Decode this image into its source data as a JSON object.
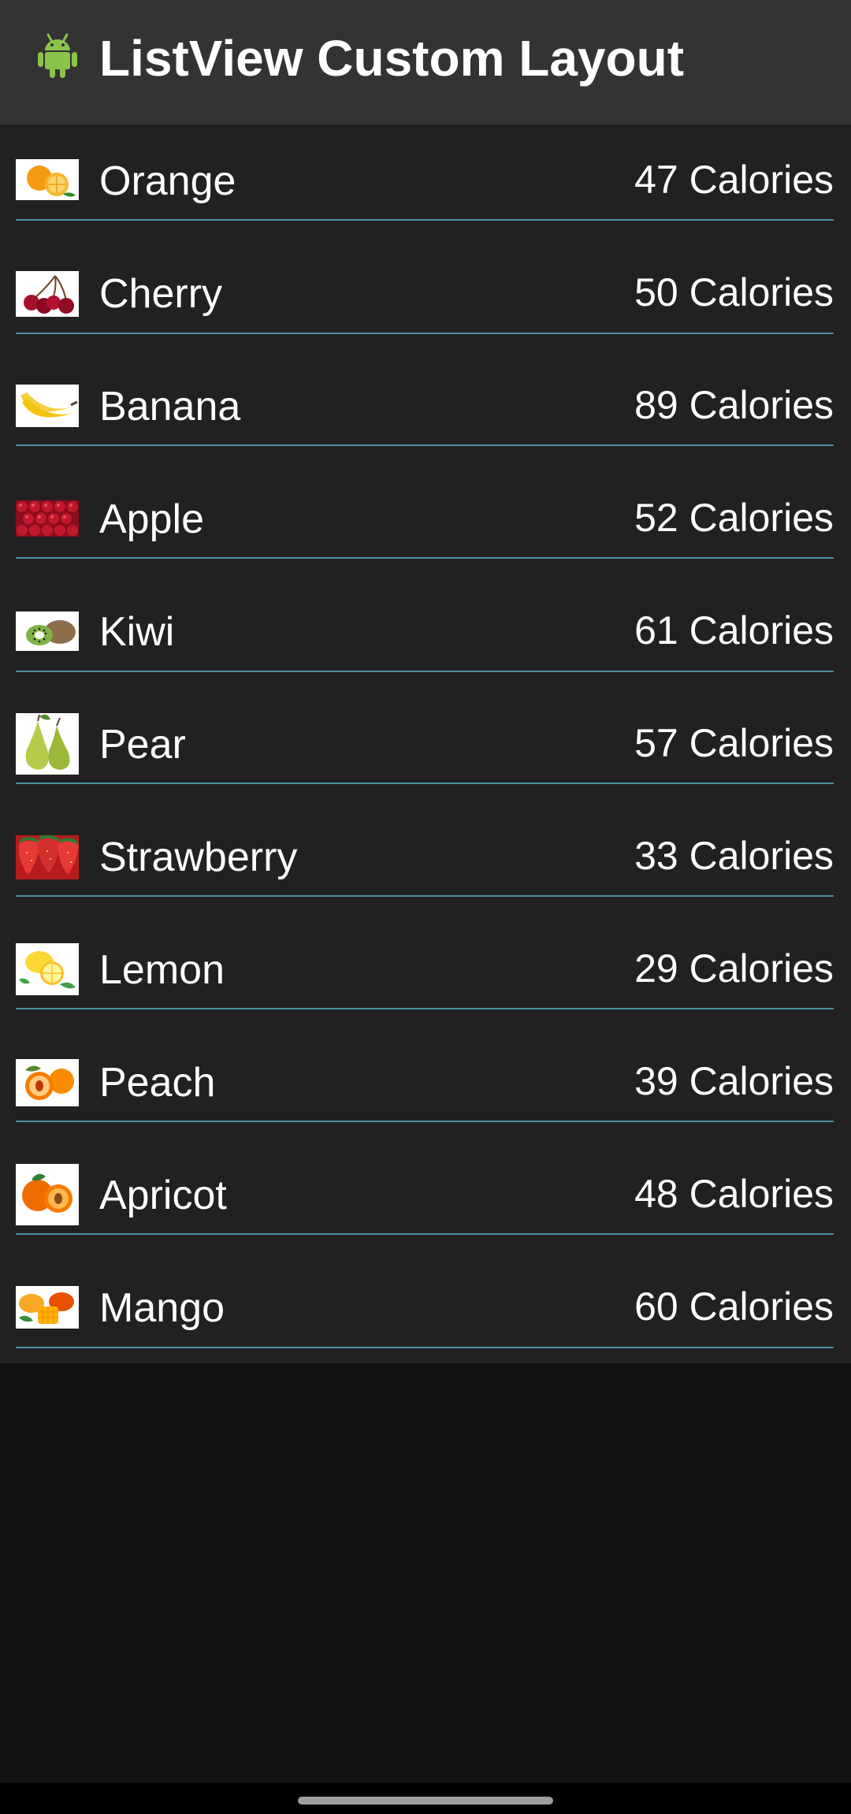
{
  "app": {
    "title": "ListView Custom Layout",
    "icon": "android-robot-icon",
    "accent_color": "#4a8fa3"
  },
  "items": [
    {
      "name": "Orange",
      "calories": "47 Calories",
      "icon": "orange-fruit-icon"
    },
    {
      "name": "Cherry",
      "calories": "50 Calories",
      "icon": "cherry-fruit-icon"
    },
    {
      "name": "Banana",
      "calories": "89 Calories",
      "icon": "banana-fruit-icon"
    },
    {
      "name": "Apple",
      "calories": "52 Calories",
      "icon": "apple-fruit-icon"
    },
    {
      "name": "Kiwi",
      "calories": "61 Calories",
      "icon": "kiwi-fruit-icon"
    },
    {
      "name": "Pear",
      "calories": "57 Calories",
      "icon": "pear-fruit-icon"
    },
    {
      "name": "Strawberry",
      "calories": "33 Calories",
      "icon": "strawberry-fruit-icon"
    },
    {
      "name": "Lemon",
      "calories": "29 Calories",
      "icon": "lemon-fruit-icon"
    },
    {
      "name": "Peach",
      "calories": "39 Calories",
      "icon": "peach-fruit-icon"
    },
    {
      "name": "Apricot",
      "calories": "48 Calories",
      "icon": "apricot-fruit-icon"
    },
    {
      "name": "Mango",
      "calories": "60 Calories",
      "icon": "mango-fruit-icon"
    }
  ]
}
